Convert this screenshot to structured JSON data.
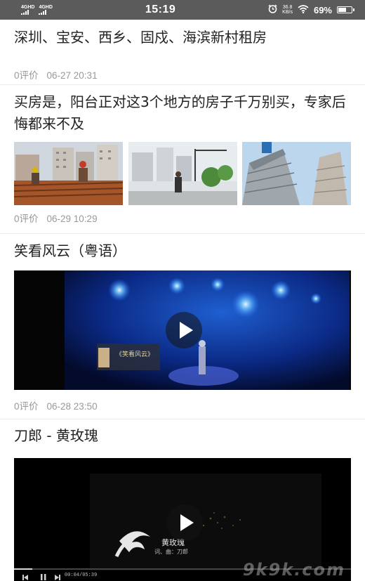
{
  "status_bar": {
    "signal1": "4GHD",
    "signal2": "4GHD",
    "time": "15:19",
    "alarm_icon": "alarm-icon",
    "speed_value": "36.8",
    "speed_unit": "KB/s",
    "wifi_icon": "wifi-icon",
    "battery": "69%",
    "battery_level": 0.69
  },
  "feed": [
    {
      "title": "深圳、宝安、西乡、固戍、海滨新村租房",
      "comments": "0评价",
      "time": "06-27 20:31"
    },
    {
      "title": "买房是，阳台正对这3个地方的房子千万别买，专家后悔都来不及",
      "comments": "0评价",
      "time": "06-29 10:29"
    },
    {
      "title": "笑看风云（粤语）",
      "comments": "0评价",
      "time": "06-28 23:50",
      "video_caption": "《笑看风云》"
    },
    {
      "title": "刀郎 - 黄玫瑰",
      "video_caption": "黄玫瑰",
      "video_subcaption": "词、曲：刀郎",
      "player_time": "00:04/05:39"
    }
  ],
  "watermark": "9k9k.com"
}
